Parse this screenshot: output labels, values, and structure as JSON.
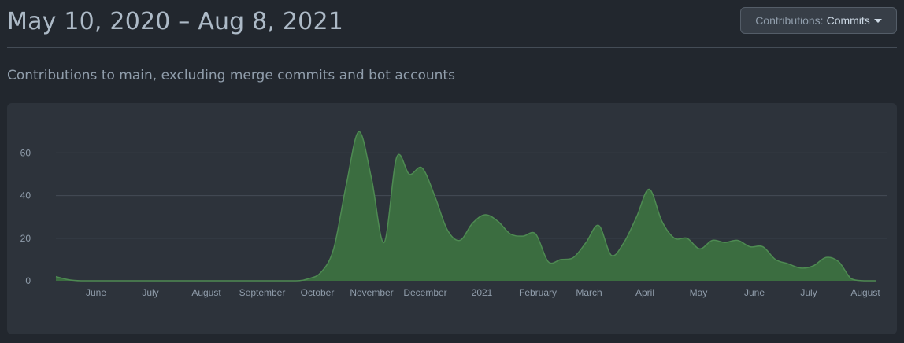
{
  "header": {
    "date_range": "May 10, 2020 – Aug 8, 2021",
    "dropdown_label": "Contributions:",
    "dropdown_value": "Commits"
  },
  "subtitle": "Contributions to main, excluding merge commits and bot accounts",
  "colors": {
    "area_fill": "#3b6d40",
    "area_stroke": "#4e8a52",
    "grid": "#444c56",
    "background": "#22272e",
    "panel": "#2d333b"
  },
  "chart_data": {
    "type": "area",
    "title": "",
    "xlabel": "",
    "ylabel": "",
    "ylim": [
      0,
      72
    ],
    "yticks": [
      0,
      20,
      40,
      60
    ],
    "grid": true,
    "x_ticks": [
      "June",
      "July",
      "August",
      "September",
      "October",
      "November",
      "December",
      "2021",
      "February",
      "March",
      "April",
      "May",
      "June",
      "July",
      "August"
    ],
    "series": [
      {
        "x": [
          "2020-05-10",
          "2020-05-17",
          "2020-05-24",
          "2020-06-01",
          "2020-07-01",
          "2020-08-01",
          "2020-09-01",
          "2020-09-20",
          "2020-09-27",
          "2020-10-04",
          "2020-10-11",
          "2020-10-18",
          "2020-10-25",
          "2020-11-01",
          "2020-11-08",
          "2020-11-15",
          "2020-11-22",
          "2020-11-29",
          "2020-12-06",
          "2020-12-13",
          "2020-12-20",
          "2020-12-27",
          "2021-01-03",
          "2021-01-10",
          "2021-01-17",
          "2021-01-24",
          "2021-01-31",
          "2021-02-07",
          "2021-02-14",
          "2021-02-21",
          "2021-02-28",
          "2021-03-07",
          "2021-03-14",
          "2021-03-21",
          "2021-03-28",
          "2021-04-04",
          "2021-04-11",
          "2021-04-18",
          "2021-04-25",
          "2021-05-02",
          "2021-05-09",
          "2021-05-16",
          "2021-05-23",
          "2021-05-30",
          "2021-06-06",
          "2021-06-13",
          "2021-06-20",
          "2021-06-27",
          "2021-07-04",
          "2021-07-11",
          "2021-07-18",
          "2021-07-25",
          "2021-08-01",
          "2021-08-08"
        ],
        "values": [
          2,
          0.5,
          0,
          0,
          0,
          0,
          0,
          0,
          1,
          4,
          15,
          45,
          70,
          48,
          18,
          58,
          50,
          53,
          40,
          24,
          19,
          27,
          31,
          28,
          22,
          21,
          22,
          9,
          10,
          11,
          18,
          26,
          12,
          18,
          30,
          43,
          28,
          20,
          20,
          15,
          19,
          18,
          19,
          16,
          16,
          10,
          8,
          6,
          7,
          11,
          9,
          1,
          0,
          0
        ]
      }
    ]
  }
}
